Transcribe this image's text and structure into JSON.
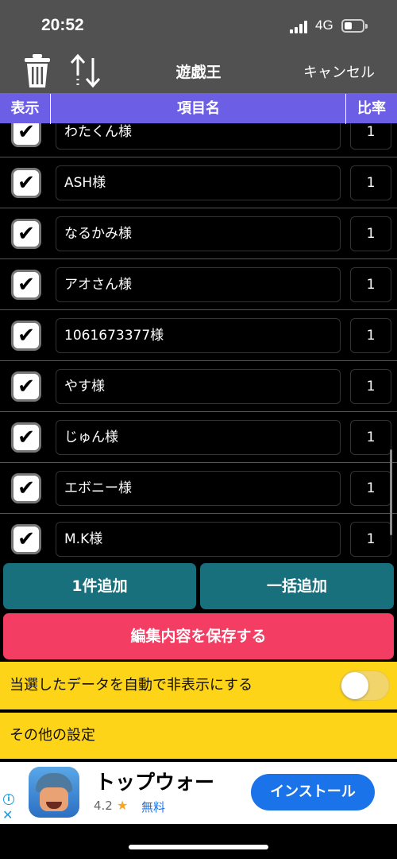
{
  "status_bar": {
    "time": "20:52",
    "network": "4G"
  },
  "header": {
    "title": "遊戯王",
    "cancel_label": "キャンセル"
  },
  "columns": {
    "show": "表示",
    "name": "項目名",
    "rate": "比率"
  },
  "items": [
    {
      "name": "わたくん様",
      "rate": "1",
      "checked": "✔"
    },
    {
      "name": "ASH様",
      "rate": "1",
      "checked": "✔"
    },
    {
      "name": "なるかみ様",
      "rate": "1",
      "checked": "✔"
    },
    {
      "name": "アオさん様",
      "rate": "1",
      "checked": "✔"
    },
    {
      "name": "1061673377様",
      "rate": "1",
      "checked": "✔"
    },
    {
      "name": "やす様",
      "rate": "1",
      "checked": "✔"
    },
    {
      "name": "じゅん様",
      "rate": "1",
      "checked": "✔"
    },
    {
      "name": "エボニー様",
      "rate": "1",
      "checked": "✔"
    },
    {
      "name": "M.K様",
      "rate": "1",
      "checked": "✔"
    }
  ],
  "buttons": {
    "add_one": "1件追加",
    "add_bulk": "一括追加",
    "save": "編集内容を保存する"
  },
  "settings": {
    "auto_hide_label": "当選したデータを自動で非表示にする",
    "auto_hide_on": false,
    "other_label": "その他の設定"
  },
  "ad": {
    "title": "トップウォー",
    "rating": "4.2",
    "star": "★",
    "price": "無料",
    "install_label": "インストール",
    "info_icon": "i",
    "close_icon": "✕"
  },
  "colors": {
    "header_bg": "#515151",
    "column_header": "#6c5fe6",
    "teal_button": "#17707c",
    "save_button": "#f33d62",
    "settings_bg": "#fed418",
    "install_button": "#1a73e8"
  }
}
